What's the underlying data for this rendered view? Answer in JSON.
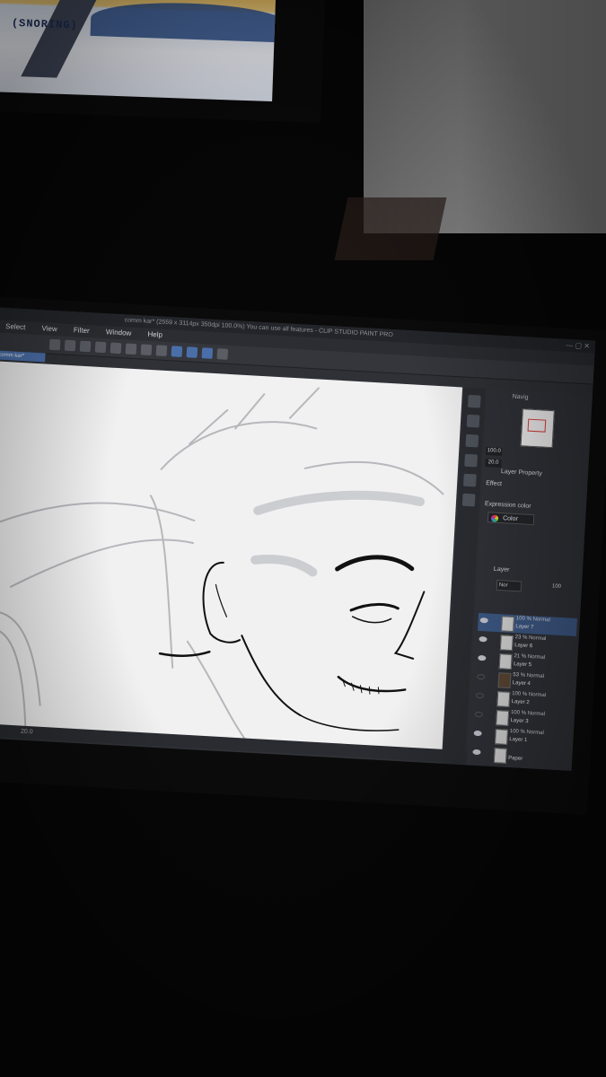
{
  "upper_screen": {
    "caption": "(SNORING)"
  },
  "app": {
    "title": "comm kar* (2559 x 3114px 350dpi 100.0%)  You can use all features - CLIP STUDIO PAINT PRO",
    "menu": [
      "Select",
      "View",
      "Filter",
      "Window",
      "Help"
    ],
    "tab": "comm kar*",
    "status": {
      "zoom": "20.0"
    },
    "navigator": {
      "label": "Navig",
      "zoom": "100.0",
      "rotate": "20.0"
    },
    "layer_property": {
      "title": "Layer Property",
      "effect": "Effect",
      "expression_label": "Expression color",
      "expression_value": "Color"
    },
    "layer_panel": {
      "title": "Layer",
      "blend_mode": "Nor",
      "opacity": "100",
      "layers": [
        {
          "mode": "100 % Normal",
          "name": "Layer 7",
          "visible": true,
          "selected": true
        },
        {
          "mode": "23 % Normal",
          "name": "Layer 6",
          "visible": true,
          "selected": false
        },
        {
          "mode": "21 % Normal",
          "name": "Layer 5",
          "visible": true,
          "selected": false
        },
        {
          "mode": "53 % Normal",
          "name": "Layer 4",
          "visible": false,
          "selected": false
        },
        {
          "mode": "100 % Normal",
          "name": "Layer 2",
          "visible": false,
          "selected": false
        },
        {
          "mode": "100 % Normal",
          "name": "Layer 3",
          "visible": false,
          "selected": false
        },
        {
          "mode": "100 % Normal",
          "name": "Layer 1",
          "visible": true,
          "selected": false
        },
        {
          "mode": "",
          "name": "Paper",
          "visible": true,
          "selected": false
        }
      ]
    },
    "colors": {
      "accent": "#4a6ea8",
      "panel": "#303238",
      "canvas": "#f1f1f2"
    }
  }
}
